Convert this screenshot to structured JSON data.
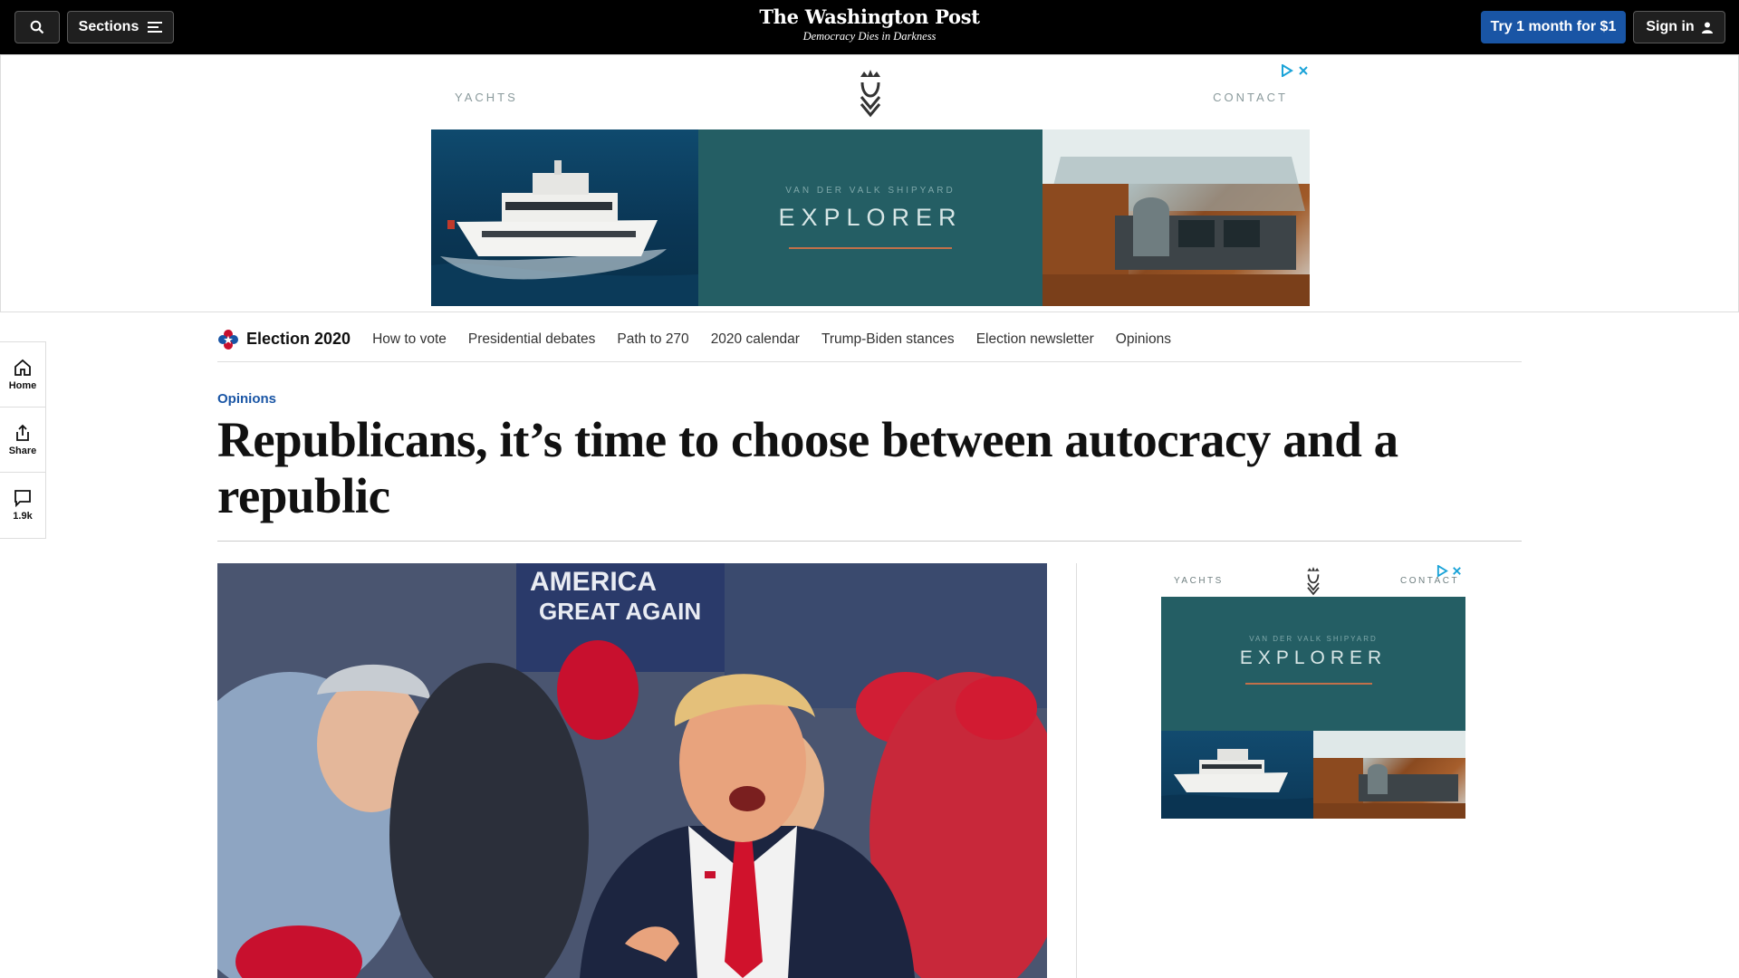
{
  "topbar": {
    "sections_label": "Sections",
    "logo_name": "The Washington Post",
    "logo_tagline": "Democracy Dies in Darkness",
    "trial_label": "Try 1 month for $1",
    "signin_label": "Sign in"
  },
  "top_ad": {
    "left_word": "YACHTS",
    "right_word": "CONTACT",
    "subtitle": "VAN DER VALK SHIPYARD",
    "title": "EXPLORER"
  },
  "rail": {
    "home_label": "Home",
    "share_label": "Share",
    "comments_label": "1.9k"
  },
  "election_nav": {
    "title": "Election 2020",
    "links": [
      "How to vote",
      "Presidential debates",
      "Path to 270",
      "2020 calendar",
      "Trump-Biden stances",
      "Election newsletter",
      "Opinions"
    ]
  },
  "article": {
    "kicker": "Opinions",
    "headline": "Republicans, it’s time to choose between autocracy and a republic"
  },
  "hero_sign": {
    "line1": "AMERICA",
    "line2": "GREAT AGAIN"
  },
  "side_ad": {
    "left_word": "YACHTS",
    "right_word": "CONTACT",
    "subtitle": "VAN DER VALK SHIPYARD",
    "title": "EXPLORER"
  },
  "colors": {
    "accent_blue": "#1955a5",
    "ad_teal": "#245e64",
    "ad_rule": "#c2704a"
  }
}
